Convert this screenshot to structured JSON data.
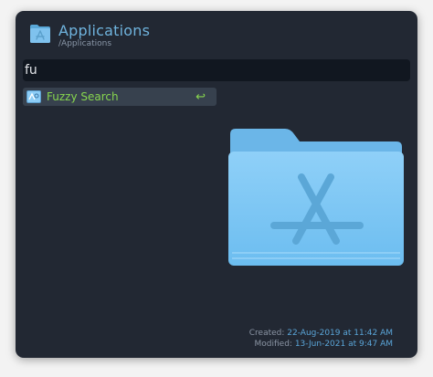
{
  "header": {
    "icon": "app-folder-icon",
    "title": "Applications",
    "path": "/Applications"
  },
  "search": {
    "value": "fu"
  },
  "results": [
    {
      "icon": "fuzzy-search-workflow-icon",
      "label": "Fuzzy Search",
      "action_glyph": "↩"
    }
  ],
  "preview": {
    "icon": "applications-folder-icon"
  },
  "meta": {
    "created_label": "Created:",
    "created_value": "22-Aug-2019 at 11:42 AM",
    "modified_label": "Modified:",
    "modified_value": "13-Jun-2021 at 9:47 AM"
  },
  "colors": {
    "background": "#222833",
    "accent": "#6fb3dd",
    "result_green": "#87d64e",
    "folder_blue": "#8ccdf7"
  }
}
